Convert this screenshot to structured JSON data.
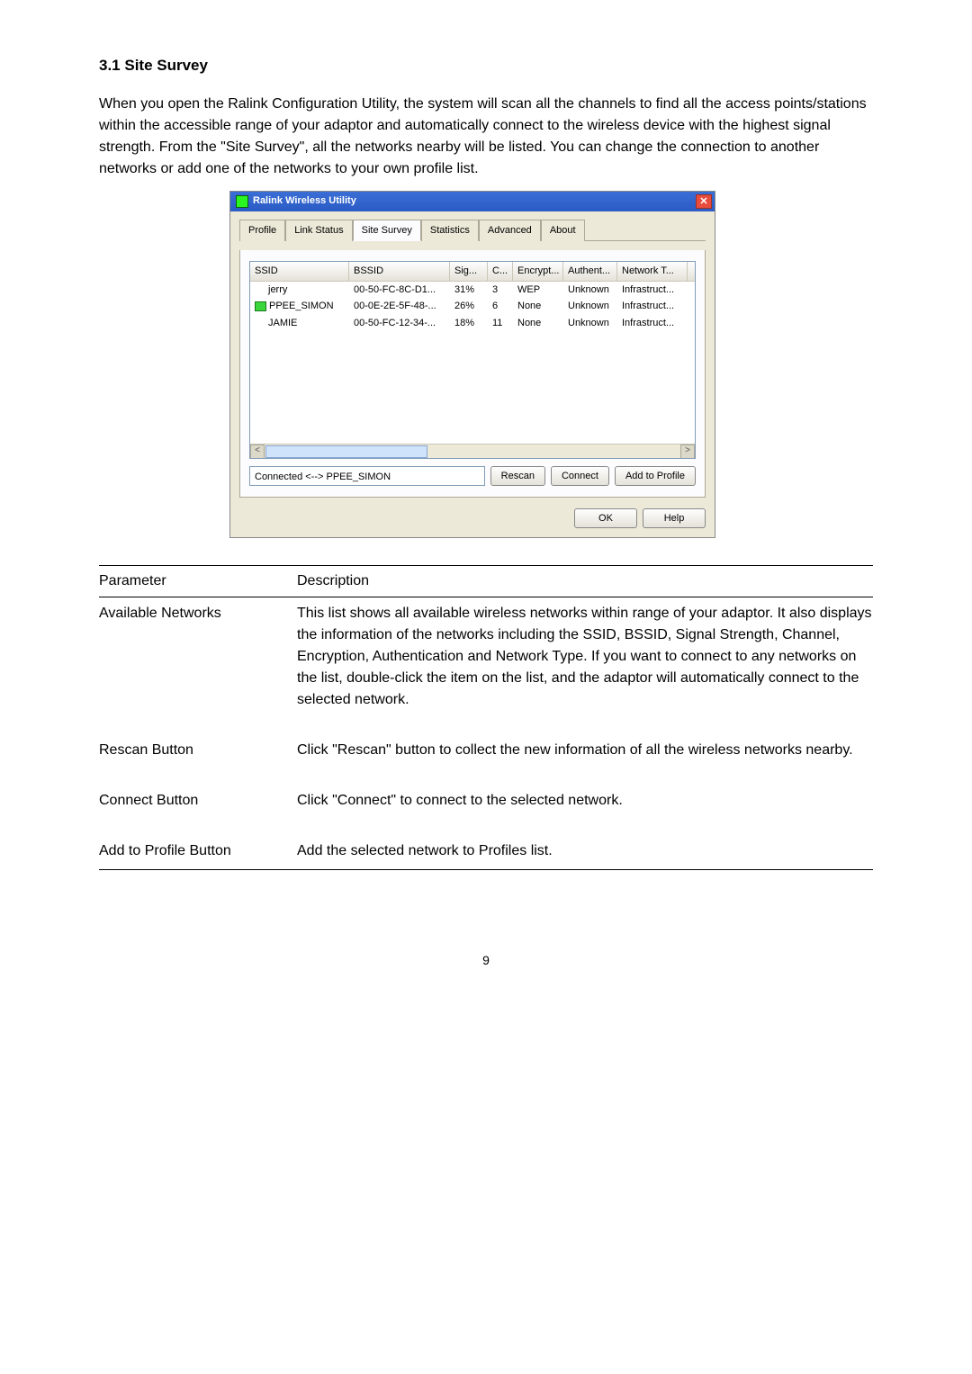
{
  "heading": "3.1    Site Survey",
  "intro": "When you open the Ralink Configuration Utility, the system will scan all the channels to find all the access points/stations within the accessible range of your adaptor and automatically connect to the wireless device with the highest signal strength. From the \"Site Survey\", all the networks nearby will be listed. You can change the connection to another networks or add one of the networks to your own profile list.",
  "window": {
    "title": "Ralink Wireless Utility",
    "tabs": [
      "Profile",
      "Link Status",
      "Site Survey",
      "Statistics",
      "Advanced",
      "About"
    ],
    "active_tab": 2,
    "columns": [
      "SSID",
      "BSSID",
      "Sig...",
      "C...",
      "Encrypt...",
      "Authent...",
      "Network T..."
    ],
    "rows": [
      {
        "ssid": "jerry",
        "bssid": "00-50-FC-8C-D1...",
        "sig": "31%",
        "ch": "3",
        "enc": "WEP",
        "auth": "Unknown",
        "net": "Infrastruct..."
      },
      {
        "ssid": "PPEE_SIMON",
        "bssid": "00-0E-2E-5F-48-...",
        "sig": "26%",
        "ch": "6",
        "enc": "None",
        "auth": "Unknown",
        "net": "Infrastruct...",
        "icon": true
      },
      {
        "ssid": "JAMIE",
        "bssid": "00-50-FC-12-34-...",
        "sig": "18%",
        "ch": "11",
        "enc": "None",
        "auth": "Unknown",
        "net": "Infrastruct..."
      }
    ],
    "status": "Connected <--> PPEE_SIMON",
    "btn_rescan": "Rescan",
    "btn_connect": "Connect",
    "btn_add": "Add to Profile",
    "btn_ok": "OK",
    "btn_help": "Help"
  },
  "table_header": {
    "param": "Parameter",
    "desc": "Description"
  },
  "params": [
    {
      "name": "Available Networks",
      "desc": "This list shows all available wireless networks within range of your adaptor. It also displays the information of the networks including the SSID, BSSID, Signal Strength, Channel, Encryption, Authentication and Network Type. If you want to connect to any networks on the list, double-click the item on the list, and the adaptor will automatically connect to the selected network."
    },
    {
      "name": "Rescan Button",
      "desc": "Click \"Rescan\" button to collect the new information of all the wireless networks nearby."
    },
    {
      "name": "Connect Button",
      "desc": "Click \"Connect\" to connect to the selected network."
    },
    {
      "name": "Add to Profile Button",
      "desc": "Add the selected network to Profiles list."
    }
  ],
  "page_number": "9"
}
